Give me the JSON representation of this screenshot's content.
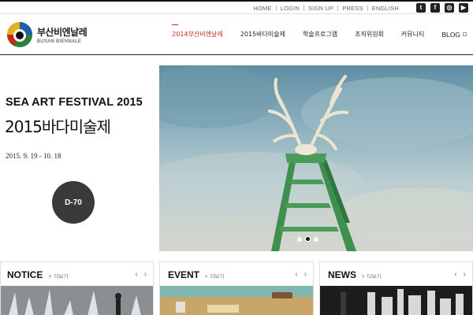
{
  "utility_links": [
    "HOME",
    "LOGIN",
    "SIGN UP",
    "PRESS",
    "ENGLISH"
  ],
  "social_icons": [
    "twitter-icon",
    "facebook-icon",
    "instagram-icon",
    "youtube-icon"
  ],
  "social_labels": {
    "twitter": "t",
    "facebook": "f",
    "instagram": "◎",
    "youtube": "▶"
  },
  "logo": {
    "korean": "부산비엔날레",
    "english": "BUSAN BIENNALE"
  },
  "nav": {
    "items": [
      "2014부산비엔날레",
      "2015바다미술제",
      "학술프로그램",
      "조직위원회",
      "커뮤니티"
    ],
    "active_index": 0,
    "blog": "BLOG"
  },
  "hero": {
    "title_en": "SEA ART FESTIVAL 2015",
    "title_ko": "2015바다미술제",
    "date": "2015. 9. 19 - 10. 18",
    "dday": "D-70",
    "slides": 3,
    "active_slide": 1
  },
  "panels": {
    "notice": {
      "title": "NOTICE",
      "more": "+ 더보기"
    },
    "event": {
      "title": "EVENT",
      "more": "+ 더보기"
    },
    "news": {
      "title": "NEWS",
      "more": "+ 더보기"
    },
    "prev": "‹",
    "next": "›"
  },
  "colors": {
    "accent": "#c8281e",
    "ladder": "#3f8f4f",
    "dday_bg": "#3a3a3a"
  }
}
